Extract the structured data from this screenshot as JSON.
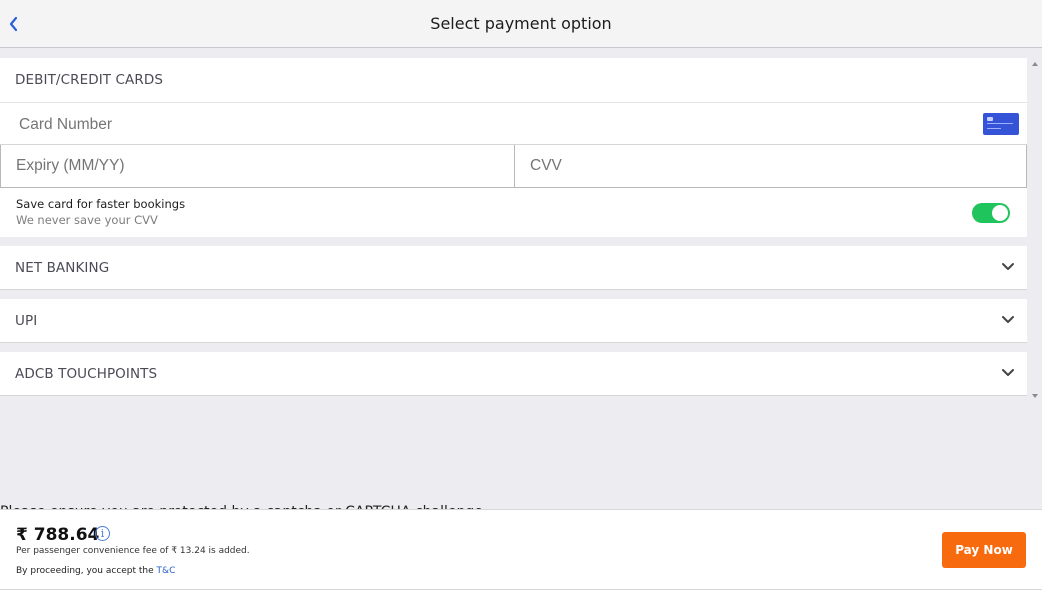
{
  "header": {
    "title": "Select payment option",
    "back_icon": "chevron-left-icon"
  },
  "cards": {
    "title": "DEBIT/CREDIT CARDS",
    "card_number_placeholder": "Card Number",
    "expiry_placeholder": "Expiry (MM/YY)",
    "cvv_placeholder": "CVV",
    "card_icon": "credit-card-icon",
    "save_label": "Save card for faster bookings",
    "save_sub": "We never save your CVV",
    "save_enabled": true
  },
  "sections": [
    {
      "title": "NET BANKING",
      "icon": "chevron-down-icon"
    },
    {
      "title": "UPI",
      "icon": "chevron-down-icon"
    },
    {
      "title": "ADCB TOUCHPOINTS",
      "icon": "chevron-down-icon"
    }
  ],
  "captcha_text": "Please ensure you are protected by a captcha or CAPTCHA challenge",
  "footer": {
    "price": "₹ 788.64",
    "info_icon": "i",
    "fee_text": "Per passenger convenience fee of ₹ 13.24 is added.",
    "tc_prefix": "By proceeding, you accept the ",
    "tc_link": "T&C",
    "pay_label": "Pay Now"
  },
  "colors": {
    "accent": "#f76a0d",
    "toggle_on": "#1fc45c",
    "link": "#2a63c8",
    "card_icon": "#3553d6"
  }
}
